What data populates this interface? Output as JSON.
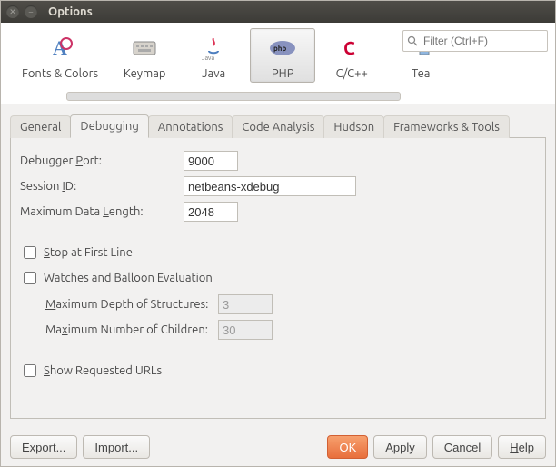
{
  "window": {
    "title": "Options"
  },
  "search": {
    "placeholder": "Filter (Ctrl+F)"
  },
  "toolbar": {
    "items": [
      {
        "label": "Fonts & Colors",
        "icon": "fonts-colors-icon"
      },
      {
        "label": "Keymap",
        "icon": "keymap-icon"
      },
      {
        "label": "Java",
        "icon": "java-icon"
      },
      {
        "label": "PHP",
        "icon": "php-icon",
        "selected": true
      },
      {
        "label": "C/C++",
        "icon": "c-cpp-icon"
      },
      {
        "label": "Team",
        "icon": "team-icon"
      }
    ]
  },
  "tabs": {
    "items": [
      "General",
      "Debugging",
      "Annotations",
      "Code Analysis",
      "Hudson",
      "Frameworks & Tools"
    ],
    "active": 1
  },
  "form": {
    "debugger_port_label": "Debugger Port:",
    "debugger_port_value": "9000",
    "session_id_label": "Session ID:",
    "session_id_value": "netbeans-xdebug",
    "max_data_length_label": "Maximum Data Length:",
    "max_data_length_value": "2048",
    "stop_first_line_label": "Stop at First Line",
    "stop_first_line_checked": false,
    "watches_label": "Watches and Balloon Evaluation",
    "watches_checked": false,
    "max_depth_label": "Maximum Depth of Structures:",
    "max_depth_value": "3",
    "max_children_label": "Maximum Number of Children:",
    "max_children_value": "30",
    "show_urls_label": "Show Requested URLs",
    "show_urls_checked": false
  },
  "footer": {
    "export": "Export...",
    "import": "Import...",
    "ok": "OK",
    "apply": "Apply",
    "cancel": "Cancel",
    "help": "Help"
  }
}
